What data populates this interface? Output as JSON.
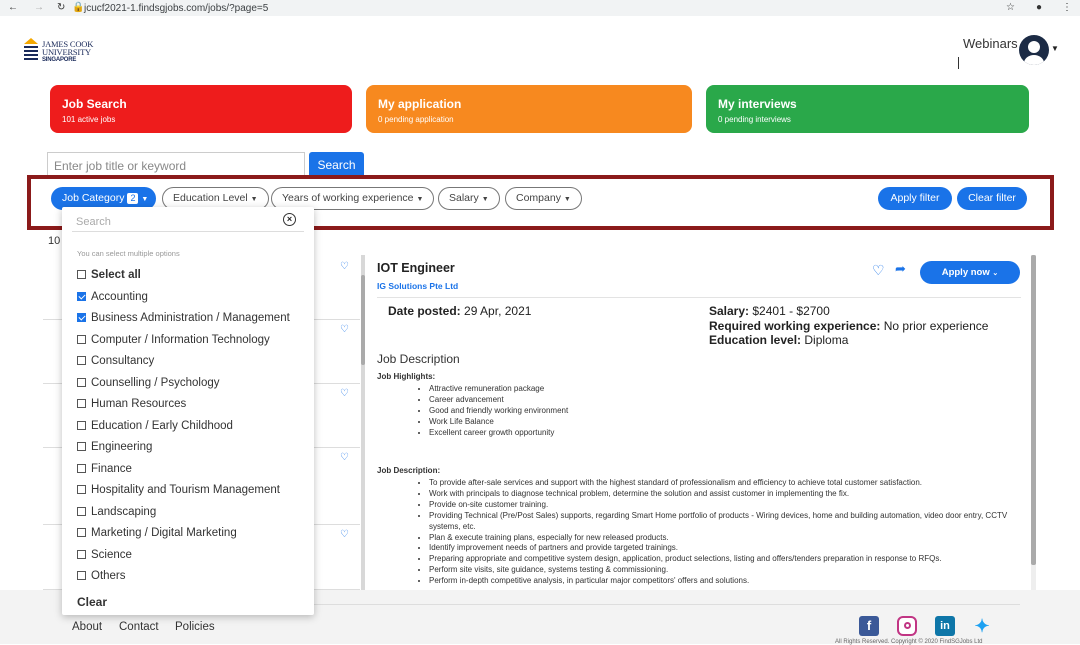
{
  "browser": {
    "url": "jcucf2021-1.findsgjobs.com/jobs/?page=5"
  },
  "brand": {
    "line1": "JAMES COOK",
    "line2": "UNIVERSITY",
    "line3": "SINGAPORE"
  },
  "header": {
    "webinars": "Webinars"
  },
  "tiles": [
    {
      "title": "Job Search",
      "sub": "101 active jobs",
      "color": "#ee1c1c"
    },
    {
      "title": "My application",
      "sub": "0 pending application",
      "color": "#f7891f"
    },
    {
      "title": "My interviews",
      "sub": "0 pending interviews",
      "color": "#2aa84a"
    }
  ],
  "search": {
    "placeholder": "Enter job title or keyword",
    "button": "Search"
  },
  "filters": {
    "job_category": "Job Category",
    "job_category_count": "2",
    "education": "Education Level",
    "experience": "Years of working experience",
    "salary": "Salary",
    "company": "Company",
    "apply": "Apply filter",
    "clear": "Clear filter"
  },
  "results_count": "10",
  "dropdown": {
    "search_placeholder": "Search",
    "hint": "You can select multiple options",
    "select_all": "Select all",
    "options": [
      {
        "label": "Accounting",
        "checked": true
      },
      {
        "label": "Business Administration / Management",
        "checked": true
      },
      {
        "label": "Computer / Information Technology",
        "checked": false
      },
      {
        "label": "Consultancy",
        "checked": false
      },
      {
        "label": "Counselling / Psychology",
        "checked": false
      },
      {
        "label": "Human Resources",
        "checked": false
      },
      {
        "label": "Education / Early Childhood",
        "checked": false
      },
      {
        "label": "Engineering",
        "checked": false
      },
      {
        "label": "Finance",
        "checked": false
      },
      {
        "label": "Hospitality and Tourism Management",
        "checked": false
      },
      {
        "label": "Landscaping",
        "checked": false
      },
      {
        "label": "Marketing / Digital Marketing",
        "checked": false
      },
      {
        "label": "Science",
        "checked": false
      },
      {
        "label": "Others",
        "checked": false
      }
    ],
    "clear": "Clear"
  },
  "job": {
    "title": "IOT Engineer",
    "company": "IG Solutions Pte Ltd",
    "apply": "Apply now",
    "date_label": "Date posted:",
    "date": "29 Apr, 2021",
    "salary_label": "Salary:",
    "salary": "$2401 - $2700",
    "exp_label": "Required working experience:",
    "exp": "No prior experience",
    "edu_label": "Education level:",
    "edu": "Diploma",
    "desc_heading": "Job Description",
    "highlights_heading": "Job Highlights:",
    "highlights": [
      "Attractive remuneration package",
      "Career advancement",
      "Good and friendly working environment",
      "Work Life Balance",
      "Excellent career growth opportunity"
    ],
    "desc_sub_heading": "Job Description:",
    "duties": [
      "To provide after-sale services and support with the highest standard of professionalism and efficiency to achieve total customer satisfaction.",
      "Work with principals to diagnose technical problem, determine the solution and assist customer in implementing the fix.",
      "Provide on-site customer training.",
      "Providing Technical (Pre/Post Sales) supports, regarding Smart Home portfolio of products - Wiring devices, home and building automation, video door entry, CCTV systems, etc.",
      "Plan & execute training plans, especially for new released products.",
      "Identify improvement needs of partners and provide targeted trainings.",
      "Preparing appropriate and competitive system design, application, product selections, listing and offers/tenders preparation in response to RFQs.",
      "Perform site visits, site guidance, systems testing & commissioning.",
      "Perform in-depth competitive analysis, in particular major competitors' offers and solutions."
    ]
  },
  "footer": {
    "about": "About",
    "contact": "Contact",
    "policies": "Policies",
    "copyright": "All Rights Reserved. Copyright © 2020 FindSGJobs Ltd"
  },
  "icons": [
    "back-icon",
    "forward-icon",
    "reload-icon",
    "lock-icon",
    "star-icon",
    "profile-icon",
    "menu-icon",
    "heart-icon",
    "share-icon",
    "facebook-icon",
    "instagram-icon",
    "linkedin-icon",
    "twitter-icon"
  ]
}
